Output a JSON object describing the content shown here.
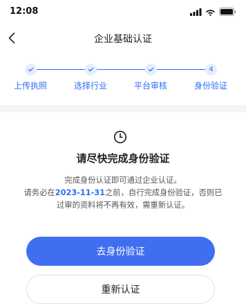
{
  "status_bar": {
    "time": "12:08",
    "icons": [
      "signal-icon",
      "wifi-icon",
      "battery-icon"
    ]
  },
  "nav": {
    "back_icon": "chevron-left-icon",
    "title": "企业基础认证"
  },
  "stepper": {
    "steps": [
      {
        "label": "上传执照",
        "state": "done"
      },
      {
        "label": "选择行业",
        "state": "done"
      },
      {
        "label": "平台审核",
        "state": "done"
      },
      {
        "label": "身份验证",
        "state": "current",
        "number": "4"
      }
    ]
  },
  "content": {
    "icon": "clock-icon",
    "title": "请尽快完成身份验证",
    "desc_line1": "完成身份认证即可通过企业认证。",
    "desc_line2_prefix": "请务必在",
    "desc_line2_date": "2023-11-31",
    "desc_line2_suffix": "之前，自行完成身份验证，否则已",
    "desc_line3": "过审的资料将不再有效，需重新认证。"
  },
  "buttons": {
    "primary": "去身份验证",
    "secondary": "重新认证"
  },
  "colors": {
    "accent": "#2b6ef2",
    "primary_button": "#3f6ff0",
    "band": "#f3f4f6"
  }
}
